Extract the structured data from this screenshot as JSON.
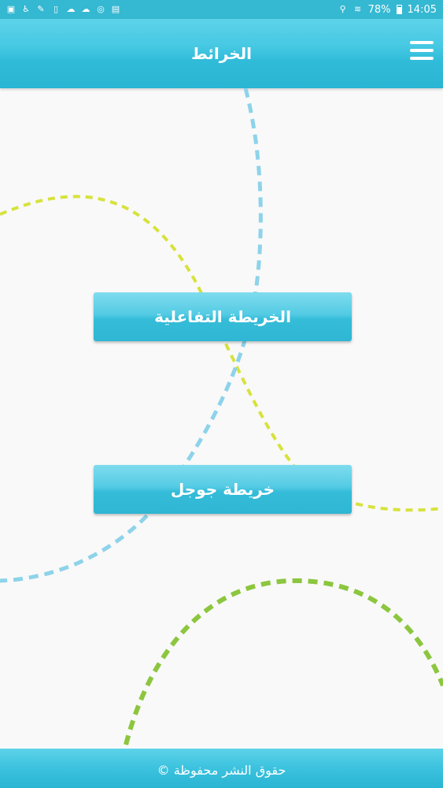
{
  "status_bar": {
    "battery": "78%",
    "time": "14:05",
    "left_icons": [
      "gallery-icon",
      "accessibility-icon",
      "wrench-icon",
      "sim-icon",
      "cloud-icon",
      "cloud-icon",
      "sync-icon",
      "clipboard-icon"
    ],
    "right_icons": [
      "location-icon",
      "wifi-icon",
      "battery-icon"
    ]
  },
  "header": {
    "title": "الخرائط",
    "menu_icon": "hamburger-menu-icon"
  },
  "buttons": {
    "interactive_map": "الخريطة التفاعلية",
    "google_map": "خريطة جوجل"
  },
  "footer": {
    "copyright": "حقوق النشر محفوظة ©"
  },
  "colors": {
    "accent": "#2ab5d3",
    "curve_blue": "#8dd3ea",
    "curve_yellow": "#d7e23c",
    "curve_green": "#8cc63f"
  }
}
